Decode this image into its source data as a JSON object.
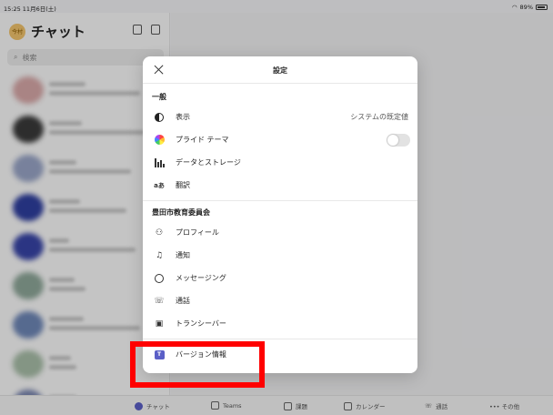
{
  "status_bar": {
    "time": "15:25 11月6日(土)",
    "battery": "89%"
  },
  "sidebar": {
    "org_badge": "今村",
    "title": "チャット",
    "search_placeholder": "検索"
  },
  "tabbar": {
    "items": [
      {
        "label": "チャット",
        "icon": "chat-icon"
      },
      {
        "label": "Teams",
        "icon": "teams-icon"
      },
      {
        "label": "課題",
        "icon": "assignment-icon"
      },
      {
        "label": "カレンダー",
        "icon": "calendar-icon"
      },
      {
        "label": "通話",
        "icon": "phone-icon"
      },
      {
        "label": "••• その他",
        "icon": "more-icon"
      }
    ]
  },
  "settings": {
    "title": "設定",
    "general": {
      "section_title": "一般",
      "display_label": "表示",
      "display_value": "システムの既定値",
      "pride_label": "プライド テーマ",
      "storage_label": "データとストレージ",
      "translate_label": "翻訳",
      "translate_icon_text": "aあ"
    },
    "org": {
      "section_title": "豊田市教育委員会",
      "profile_label": "プロフィール",
      "notify_label": "通知",
      "messaging_label": "メッセージング",
      "calls_label": "通話",
      "walkie_label": "トランシーバー"
    },
    "version_label": "バージョン情報"
  },
  "colors": {
    "accent": "#5b5fc7",
    "highlight_border": "#ff0000",
    "overlay": "rgba(0,0,0,0.22)"
  }
}
